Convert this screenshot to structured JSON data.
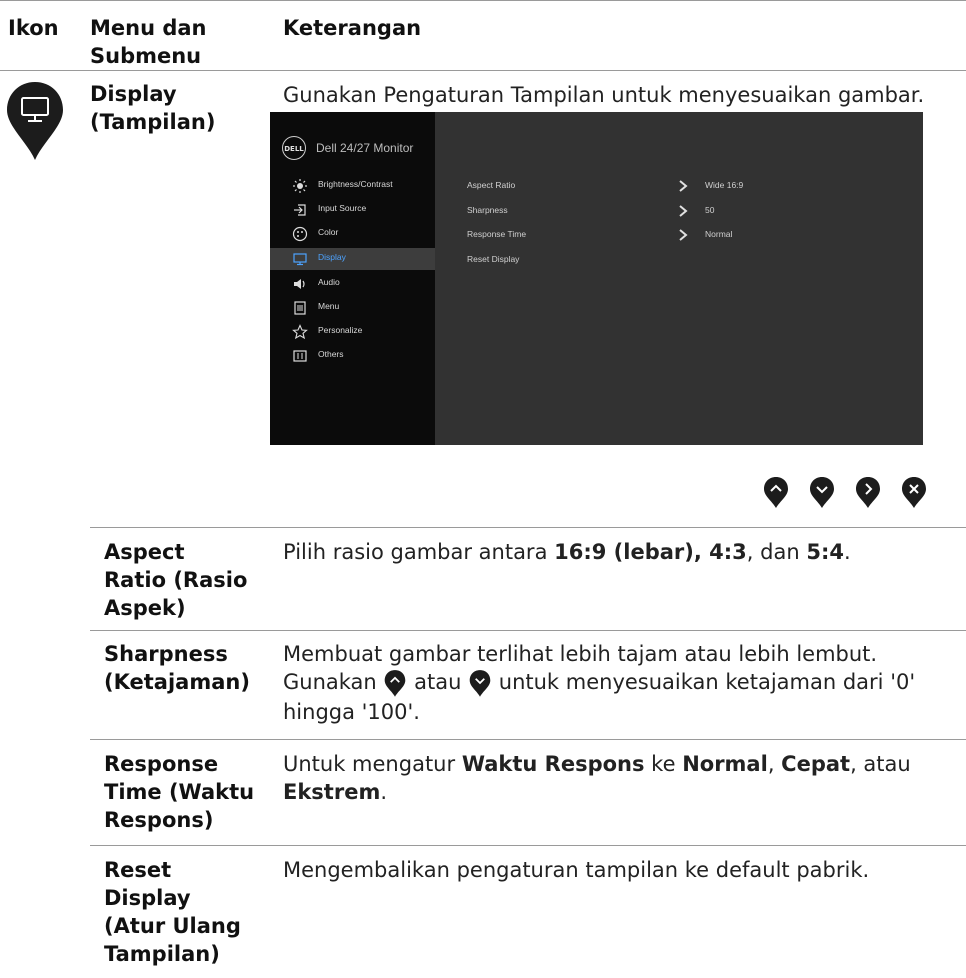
{
  "header": {
    "col_icon": "Ikon",
    "col_menu": "Menu dan Submenu",
    "col_desc": "Keterangan"
  },
  "display": {
    "label_line1": "Display",
    "label_line2": "(Tampilan)",
    "description": "Gunakan Pengaturan Tampilan untuk menyesuaikan gambar.",
    "icon": "monitor-icon"
  },
  "osd": {
    "logo": "DELL",
    "title": "Dell 24/27 Monitor",
    "menu": [
      {
        "label": "Brightness/Contrast",
        "icon": "brightness-icon"
      },
      {
        "label": "Input Source",
        "icon": "input-source-icon"
      },
      {
        "label": "Color",
        "icon": "color-icon"
      },
      {
        "label": "Display",
        "icon": "display-icon",
        "active": true
      },
      {
        "label": "Audio",
        "icon": "audio-icon"
      },
      {
        "label": "Menu",
        "icon": "menu-icon"
      },
      {
        "label": "Personalize",
        "icon": "star-icon"
      },
      {
        "label": "Others",
        "icon": "others-icon"
      }
    ],
    "settings": [
      {
        "name": "Aspect Ratio",
        "value": "Wide 16:9"
      },
      {
        "name": "Sharpness",
        "value": "50"
      },
      {
        "name": "Response Time",
        "value": "Normal"
      },
      {
        "name": "Reset Display",
        "value": ""
      }
    ],
    "active_color": "#4da3ff"
  },
  "nav_buttons": [
    "up-icon",
    "down-icon",
    "right-icon",
    "close-icon"
  ],
  "rows": [
    {
      "label_lines": [
        "Aspect",
        "Ratio (Rasio",
        "Aspek)"
      ],
      "desc_parts": [
        "Pilih rasio gambar antara ",
        "16:9 (lebar), 4:3",
        ", dan ",
        "5:4",
        "."
      ]
    },
    {
      "label_lines": [
        "Sharpness",
        "(Ketajaman)"
      ],
      "desc_line1": "Membuat gambar terlihat lebih tajam atau lebih lembut.",
      "desc_line2_a": "Gunakan",
      "desc_line2_b": "atau",
      "desc_line2_c": "untuk menyesuaikan ketajaman dari '0'",
      "desc_line3": "hingga '100'."
    },
    {
      "label_lines": [
        "Response",
        "Time (Waktu",
        "Respons)"
      ],
      "desc_parts": [
        "Untuk mengatur ",
        "Waktu Respons",
        " ke ",
        "Normal",
        ", ",
        "Cepat",
        ", atau",
        "Ekstrem",
        "."
      ]
    },
    {
      "label_lines": [
        "Reset",
        "Display",
        "(Atur Ulang",
        "Tampilan)"
      ],
      "description": "Mengembalikan pengaturan tampilan ke default pabrik."
    }
  ],
  "colors": {
    "pin": "#1c1c1c",
    "rule": "#9a9a9a"
  }
}
